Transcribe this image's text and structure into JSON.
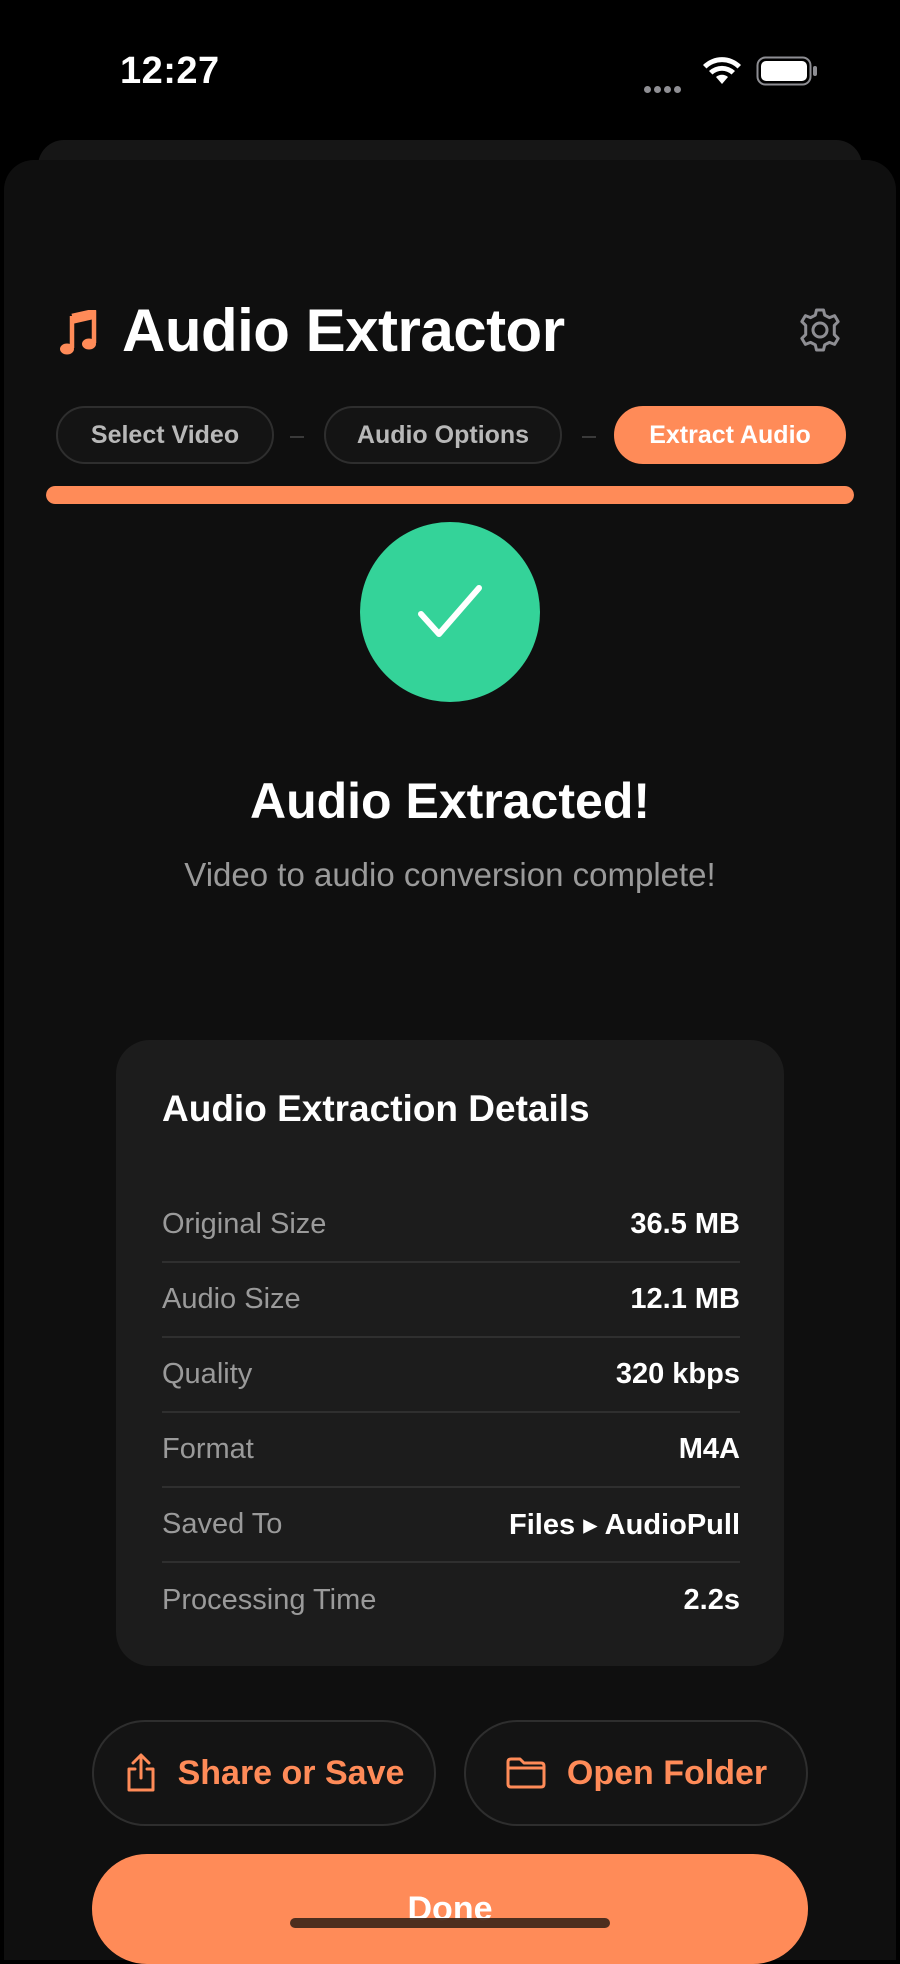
{
  "status_bar": {
    "time": "12:27"
  },
  "header": {
    "app_icon": "music-note-icon",
    "title": "Audio Extractor",
    "settings_icon": "gear-icon"
  },
  "steps": [
    {
      "label": "Select Video",
      "active": false
    },
    {
      "label": "Audio Options",
      "active": false
    },
    {
      "label": "Extract Audio",
      "active": true
    }
  ],
  "progress": {
    "value": 1.0
  },
  "success": {
    "icon": "checkmark-icon",
    "title": "Audio Extracted!",
    "subtitle": "Video to audio conversion complete!"
  },
  "details": {
    "title": "Audio Extraction Details",
    "rows": [
      {
        "label": "Original Size",
        "value": "36.5 MB"
      },
      {
        "label": "Audio Size",
        "value": "12.1 MB"
      },
      {
        "label": "Quality",
        "value": "320 kbps"
      },
      {
        "label": "Format",
        "value": "M4A"
      },
      {
        "label": "Saved To",
        "value": "Files ▸ AudioPull"
      },
      {
        "label": "Processing Time",
        "value": "2.2s"
      }
    ]
  },
  "actions": {
    "share_label": "Share or Save",
    "share_icon": "share-icon",
    "open_folder_label": "Open Folder",
    "folder_icon": "folder-icon",
    "done_label": "Done"
  },
  "colors": {
    "accent": "#ff8b58",
    "success": "#34d399",
    "background": "#000000",
    "card": "#1c1c1c"
  }
}
